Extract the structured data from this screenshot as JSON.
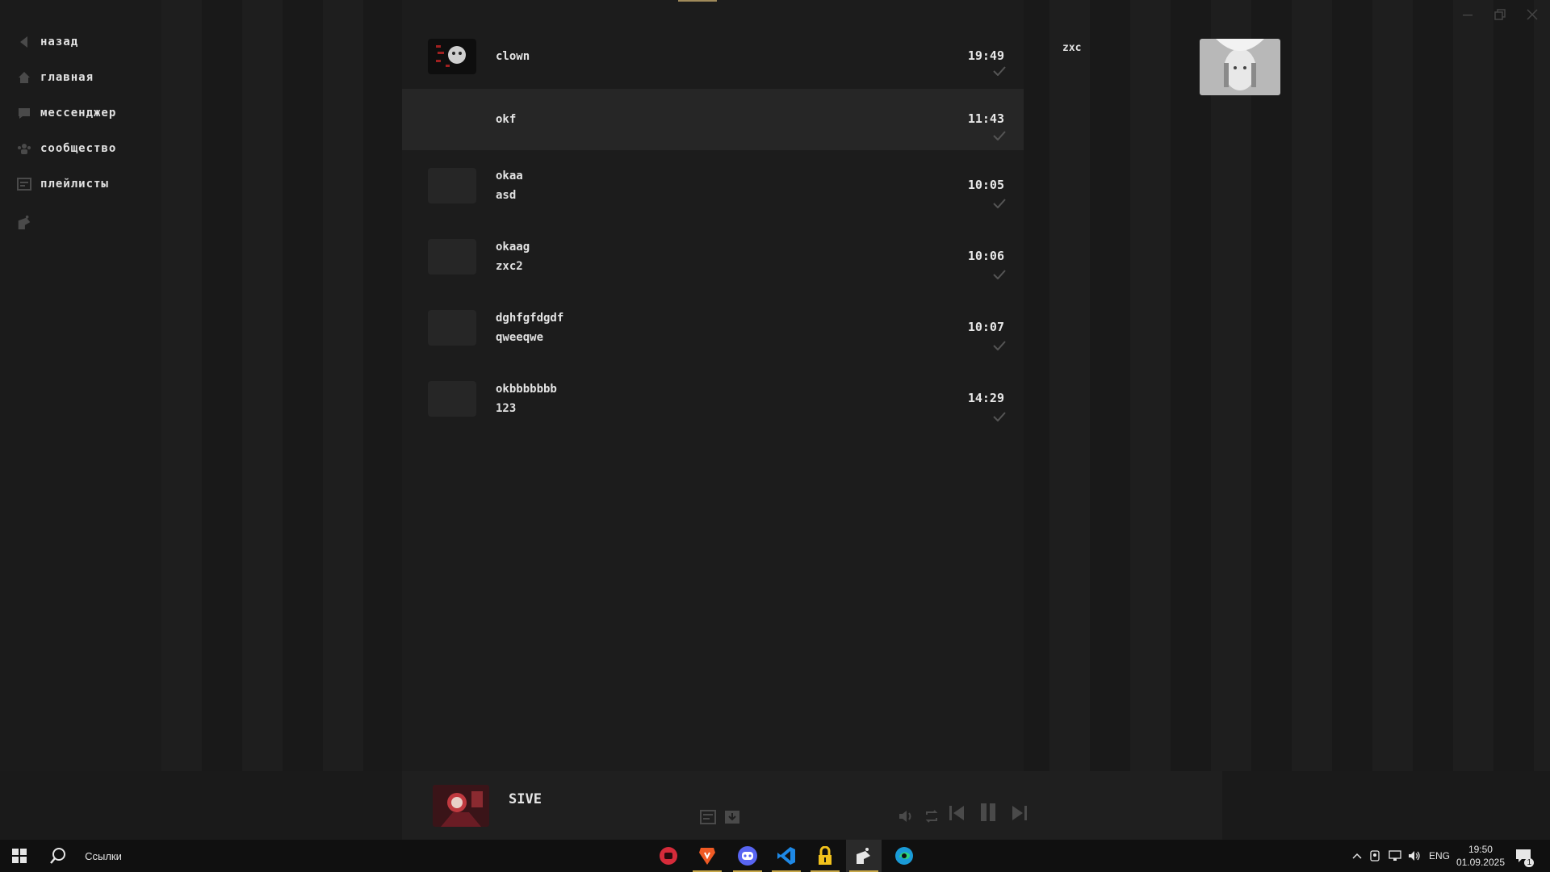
{
  "nav": [
    {
      "label": "назад",
      "icon": "back-arrow-icon"
    },
    {
      "label": "главная",
      "icon": "home-icon"
    },
    {
      "label": "мессенджер",
      "icon": "chat-bubble-icon"
    },
    {
      "label": "сообщество",
      "icon": "community-icon"
    },
    {
      "label": "плейлисты",
      "icon": "playlist-icon"
    },
    {
      "label": "",
      "icon": "app-logo-icon"
    }
  ],
  "chats": [
    {
      "name": "clown",
      "preview": "",
      "time": "19:49",
      "avatar": "clown-avatar"
    },
    {
      "name": "okf",
      "preview": "",
      "time": "11:43",
      "avatar": ""
    },
    {
      "name": "okaa",
      "preview": "asd",
      "time": "10:05",
      "avatar": ""
    },
    {
      "name": "okaag",
      "preview": "zxc2",
      "time": "10:06",
      "avatar": ""
    },
    {
      "name": "dghfgfdgdf",
      "preview": "qweeqwe",
      "time": "10:07",
      "avatar": ""
    },
    {
      "name": "okbbbbbbb",
      "preview": "123",
      "time": "14:29",
      "avatar": ""
    }
  ],
  "right_panel": {
    "label": "zxc"
  },
  "player": {
    "title": "SIVE"
  },
  "taskbar": {
    "search_label": "Ссылки",
    "lang": "ENG",
    "time": "19:50",
    "date": "01.09.2025",
    "notifications": "1"
  },
  "colors": {
    "accent": "#c8a84a",
    "panel": "#1c1c1c",
    "active_row": "#262626"
  }
}
